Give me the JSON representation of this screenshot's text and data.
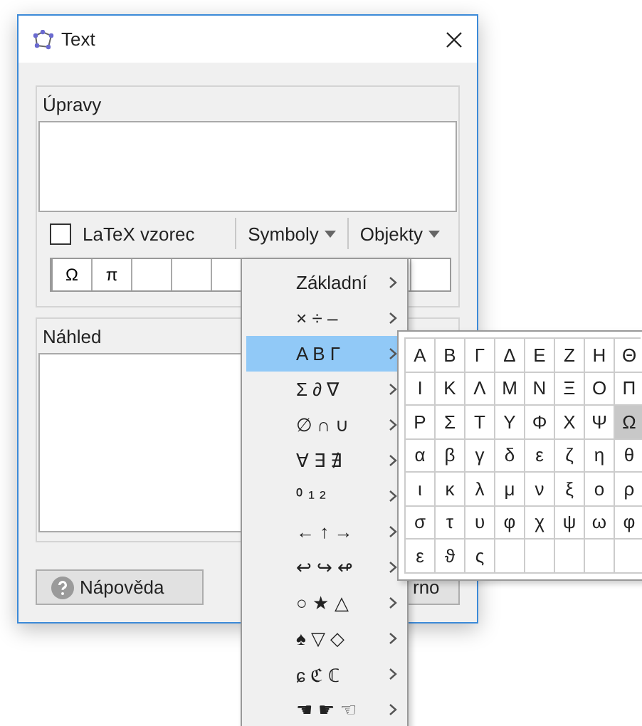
{
  "window": {
    "title": "Text"
  },
  "editor": {
    "label": "Úpravy",
    "latex": {
      "label": "LaTeX vzorec",
      "checked": false
    },
    "menus": [
      "Symboly",
      "Objekty"
    ],
    "symbol_bar": [
      "Ω",
      "π"
    ]
  },
  "preview": {
    "label": "Náhled"
  },
  "buttons": [
    {
      "label": "Nápověda",
      "kind": "help"
    },
    {
      "label": "rno",
      "kind": "plain"
    }
  ],
  "symbol_menu": [
    {
      "label": "Základní",
      "selected": false
    },
    {
      "label": "× ÷ –",
      "selected": false
    },
    {
      "label": "Α Β Γ",
      "selected": true
    },
    {
      "label": "Σ ∂ ∇",
      "selected": false
    },
    {
      "label": "∅ ∩ ∪",
      "selected": false
    },
    {
      "label": "∀ ∃ ∄",
      "selected": false
    },
    {
      "label": "⁰ ¹ ²",
      "selected": false
    },
    {
      "label": "← ↑ →",
      "selected": false
    },
    {
      "label": "↩ ↪ ↫",
      "selected": false
    },
    {
      "label": "○ ★ △",
      "selected": false
    },
    {
      "label": "♠ ▽ ◇",
      "selected": false
    },
    {
      "label": "ɕ ℭ ℂ",
      "selected": false
    },
    {
      "label": "☚ ☛ ☜",
      "selected": false
    }
  ],
  "greek_submenu": [
    [
      {
        "char": "Α",
        "selected": false
      },
      {
        "char": "Β",
        "selected": false
      },
      {
        "char": "Γ",
        "selected": false
      },
      {
        "char": "Δ",
        "selected": false
      },
      {
        "char": "Ε",
        "selected": false
      },
      {
        "char": "Ζ",
        "selected": false
      },
      {
        "char": "Η",
        "selected": false
      },
      {
        "char": "Θ",
        "selected": false
      }
    ],
    [
      {
        "char": "Ι",
        "selected": false
      },
      {
        "char": "Κ",
        "selected": false
      },
      {
        "char": "Λ",
        "selected": false
      },
      {
        "char": "Μ",
        "selected": false
      },
      {
        "char": "Ν",
        "selected": false
      },
      {
        "char": "Ξ",
        "selected": false
      },
      {
        "char": "Ο",
        "selected": false
      },
      {
        "char": "Π",
        "selected": false
      }
    ],
    [
      {
        "char": "Ρ",
        "selected": false
      },
      {
        "char": "Σ",
        "selected": false
      },
      {
        "char": "Τ",
        "selected": false
      },
      {
        "char": "Υ",
        "selected": false
      },
      {
        "char": "Φ",
        "selected": false
      },
      {
        "char": "Χ",
        "selected": false
      },
      {
        "char": "Ψ",
        "selected": false
      },
      {
        "char": "Ω",
        "selected": true
      }
    ],
    [
      {
        "char": "α",
        "selected": false
      },
      {
        "char": "β",
        "selected": false
      },
      {
        "char": "γ",
        "selected": false
      },
      {
        "char": "δ",
        "selected": false
      },
      {
        "char": "ε",
        "selected": false
      },
      {
        "char": "ζ",
        "selected": false
      },
      {
        "char": "η",
        "selected": false
      },
      {
        "char": "θ",
        "selected": false
      }
    ],
    [
      {
        "char": "ι",
        "selected": false
      },
      {
        "char": "κ",
        "selected": false
      },
      {
        "char": "λ",
        "selected": false
      },
      {
        "char": "μ",
        "selected": false
      },
      {
        "char": "ν",
        "selected": false
      },
      {
        "char": "ξ",
        "selected": false
      },
      {
        "char": "ο",
        "selected": false
      },
      {
        "char": "ρ",
        "selected": false
      }
    ],
    [
      {
        "char": "σ",
        "selected": false
      },
      {
        "char": "τ",
        "selected": false
      },
      {
        "char": "υ",
        "selected": false
      },
      {
        "char": "φ",
        "selected": false
      },
      {
        "char": "χ",
        "selected": false
      },
      {
        "char": "ψ",
        "selected": false
      },
      {
        "char": "ω",
        "selected": false
      },
      {
        "char": "φ",
        "selected": false
      }
    ],
    [
      {
        "char": "ε",
        "selected": false
      },
      {
        "char": "ϑ",
        "selected": false
      },
      {
        "char": "ς",
        "selected": false
      }
    ]
  ]
}
